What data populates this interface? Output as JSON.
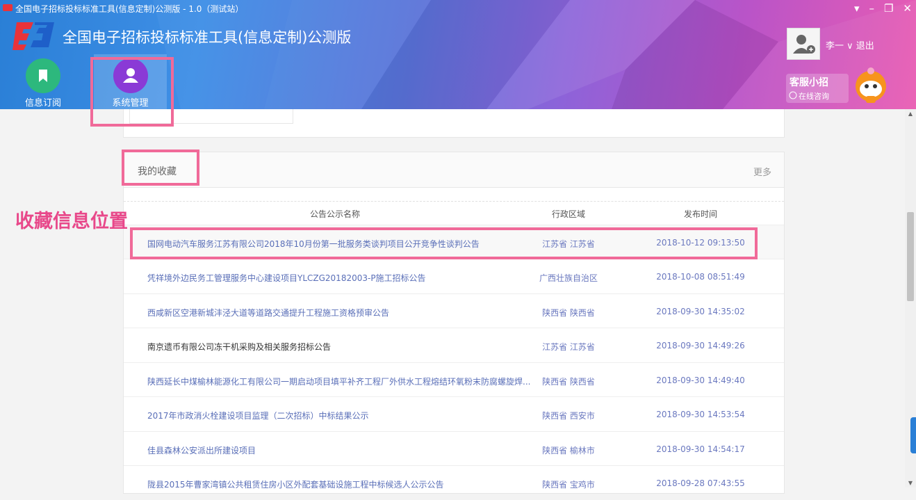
{
  "window": {
    "title": "全国电子招标投标标准工具(信息定制)公测版 - 1.0（测试站）",
    "controls": [
      "▾",
      "–",
      "❐",
      "✕"
    ]
  },
  "app": {
    "title": "全国电子招标投标标准工具(信息定制)公测版"
  },
  "nav": {
    "info_label": "信息订阅",
    "system_label": "系统管理"
  },
  "user": {
    "name": "李一 ∨ 退出"
  },
  "customer_service": {
    "title": "客服小招",
    "subtitle": "在线咨询"
  },
  "favorites": {
    "title": "我的收藏",
    "more": "更多",
    "columns": {
      "name": "公告公示名称",
      "region": "行政区域",
      "time": "发布时间"
    },
    "rows": [
      {
        "name": "国网电动汽车服务江苏有限公司2018年10月份第一批服务类谈判项目公开竞争性谈判公告",
        "region": "江苏省 江苏省",
        "time": "2018-10-12 09:13:50"
      },
      {
        "name": "凭祥境外边民务工管理服务中心建设项目YLCZG20182003-P施工招标公告",
        "region": "广西壮族自治区",
        "time": "2018-10-08 08:51:49"
      },
      {
        "name": "西咸新区空港新城沣泾大道等道路交通提升工程施工资格预审公告",
        "region": "陕西省 陕西省",
        "time": "2018-09-30 14:35:02"
      },
      {
        "name": "南京遗币有限公司冻干机采购及相关服务招标公告",
        "region": "江苏省 江苏省",
        "time": "2018-09-30 14:49:26"
      },
      {
        "name": "陕西延长中煤榆林能源化工有限公司一期启动项目填平补齐工程厂外供水工程熔结环氧粉末防腐螺旋焊...",
        "region": "陕西省 陕西省",
        "time": "2018-09-30 14:49:40"
      },
      {
        "name": "2017年市政消火栓建设项目监理（二次招标）中标结果公示",
        "region": "陕西省 西安市",
        "time": "2018-09-30 14:53:54"
      },
      {
        "name": "佳县森林公安派出所建设项目",
        "region": "陕西省 榆林市",
        "time": "2018-09-30 14:54:17"
      },
      {
        "name": "陇县2015年曹家湾镇公共租赁住房小区外配套基础设施工程中标候选人公示公告",
        "region": "陕西省 宝鸡市",
        "time": "2018-09-28 07:43:55"
      }
    ]
  },
  "annotation": {
    "label": "收藏信息位置",
    "color": "#e8488a"
  },
  "colors": {
    "header_start": "#2a7fd6",
    "header_end": "#e95cb3",
    "link": "#5a6fb8",
    "accent": "#f06a99"
  },
  "icons": [
    "logo-icon",
    "bookmark-icon",
    "user-icon",
    "avatar-icon",
    "chat-icon",
    "mascot-icon"
  ]
}
